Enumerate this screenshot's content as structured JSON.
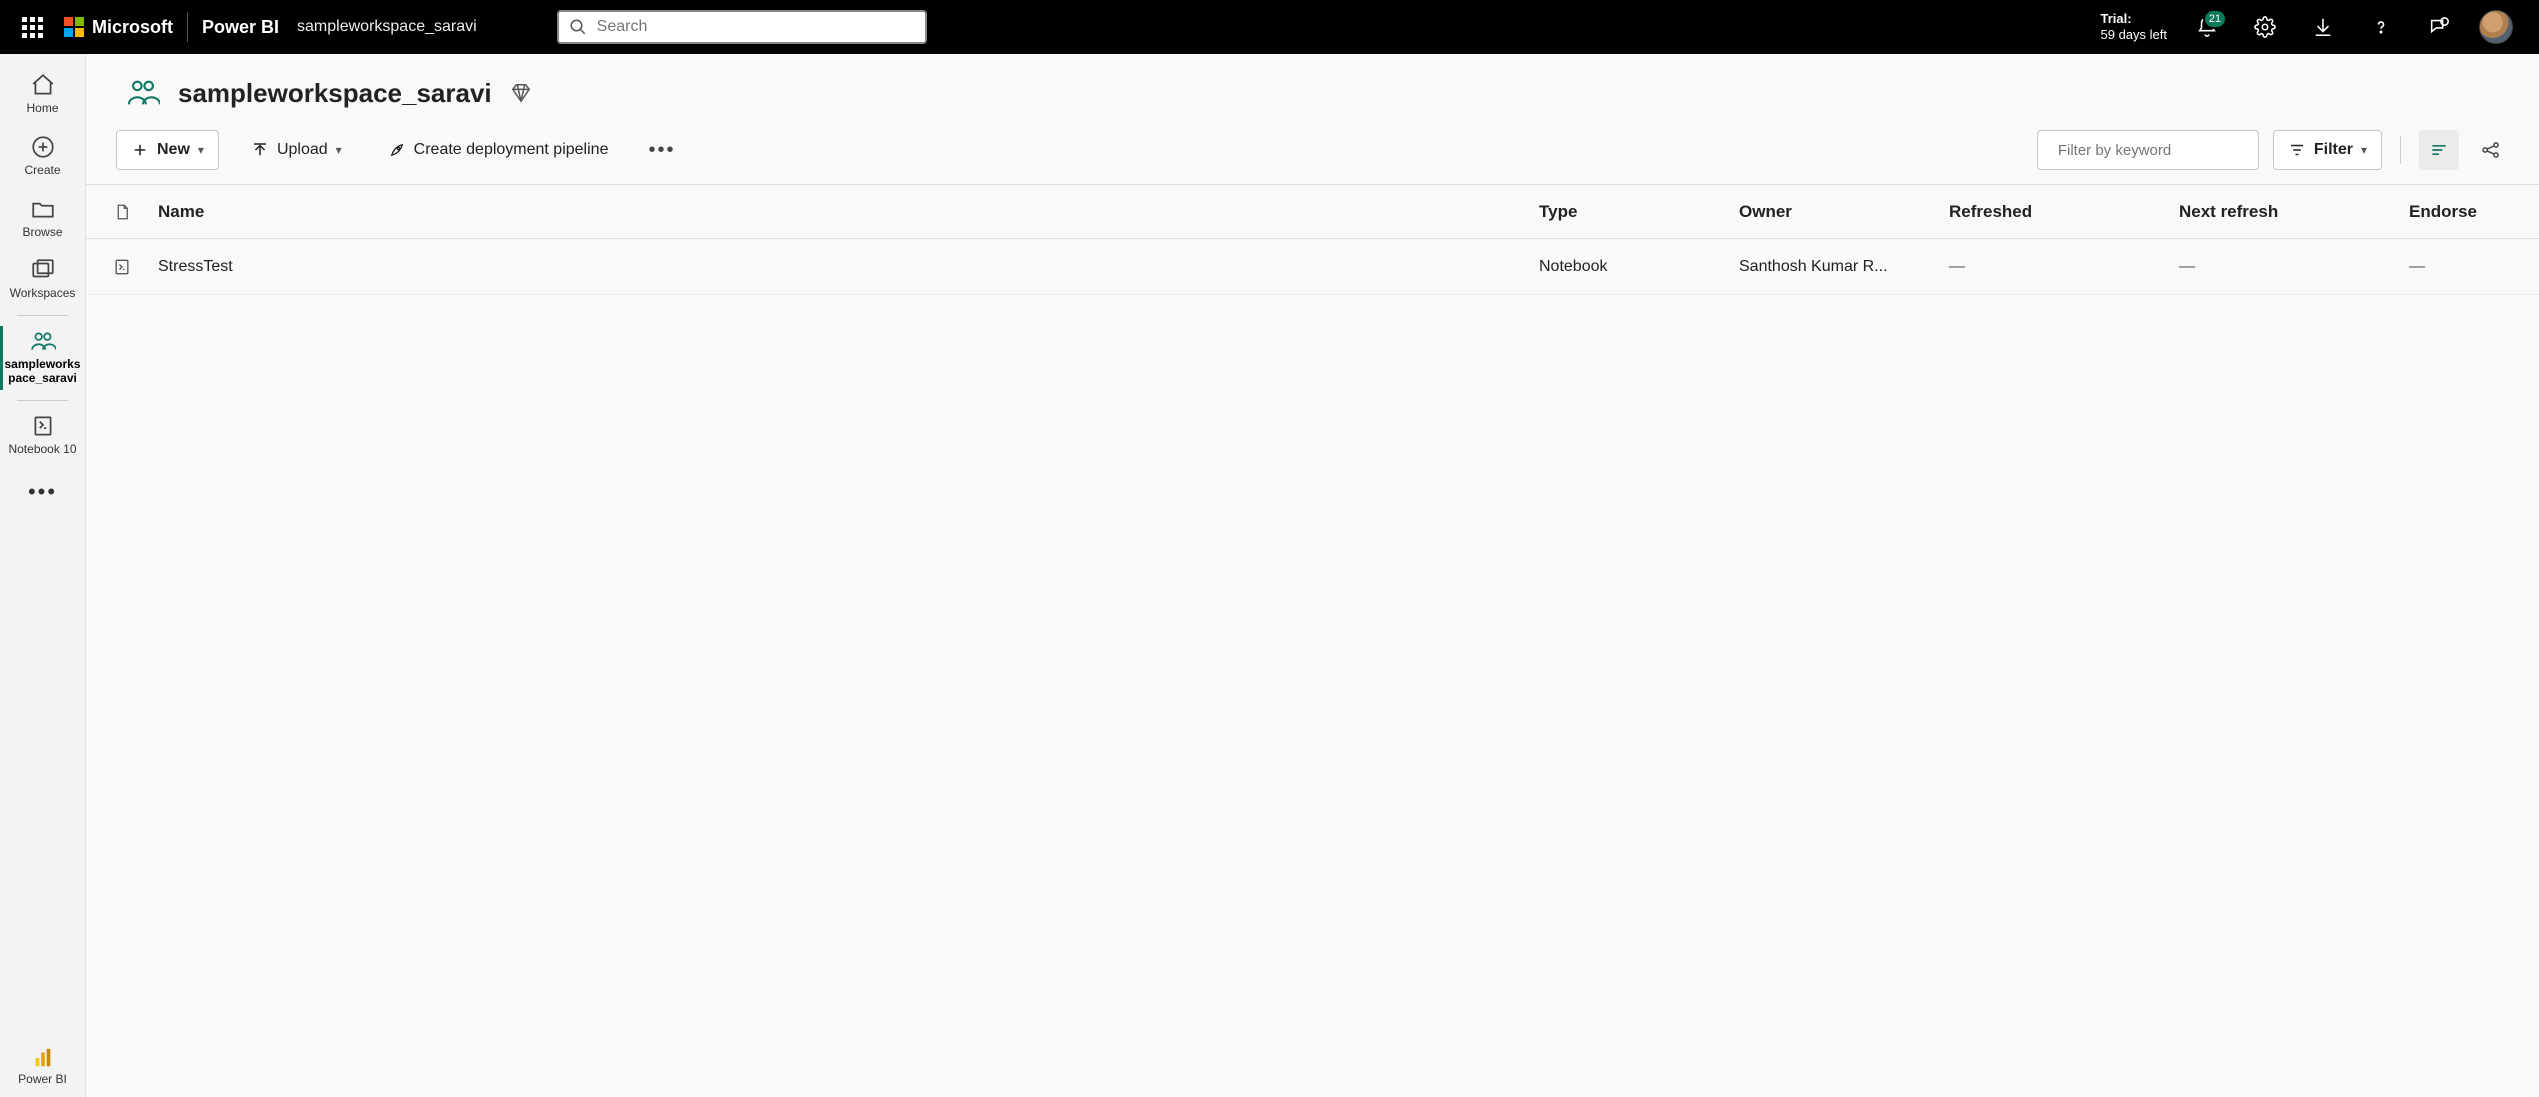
{
  "header": {
    "ms_label": "Microsoft",
    "product": "Power BI",
    "workspace_crumb": "sampleworkspace_saravi",
    "search_placeholder": "Search",
    "trial_line1": "Trial:",
    "trial_line2": "59 days left",
    "notification_count": "21"
  },
  "leftrail": {
    "home": "Home",
    "create": "Create",
    "browse": "Browse",
    "workspaces": "Workspaces",
    "active_ws": "sampleworkspace_saravi",
    "notebook": "Notebook 10",
    "powerbi": "Power BI"
  },
  "workspace": {
    "title": "sampleworkspace_saravi"
  },
  "toolbar": {
    "new": "New",
    "upload": "Upload",
    "pipeline": "Create deployment pipeline",
    "filter_placeholder": "Filter by keyword",
    "filter_label": "Filter"
  },
  "columns": {
    "name": "Name",
    "type": "Type",
    "owner": "Owner",
    "refreshed": "Refreshed",
    "next_refresh": "Next refresh",
    "endorse": "Endorse"
  },
  "rows": [
    {
      "name": "StressTest",
      "type": "Notebook",
      "owner": "Santhosh Kumar R...",
      "refreshed": "—",
      "next_refresh": "—",
      "endorse": "—"
    }
  ]
}
